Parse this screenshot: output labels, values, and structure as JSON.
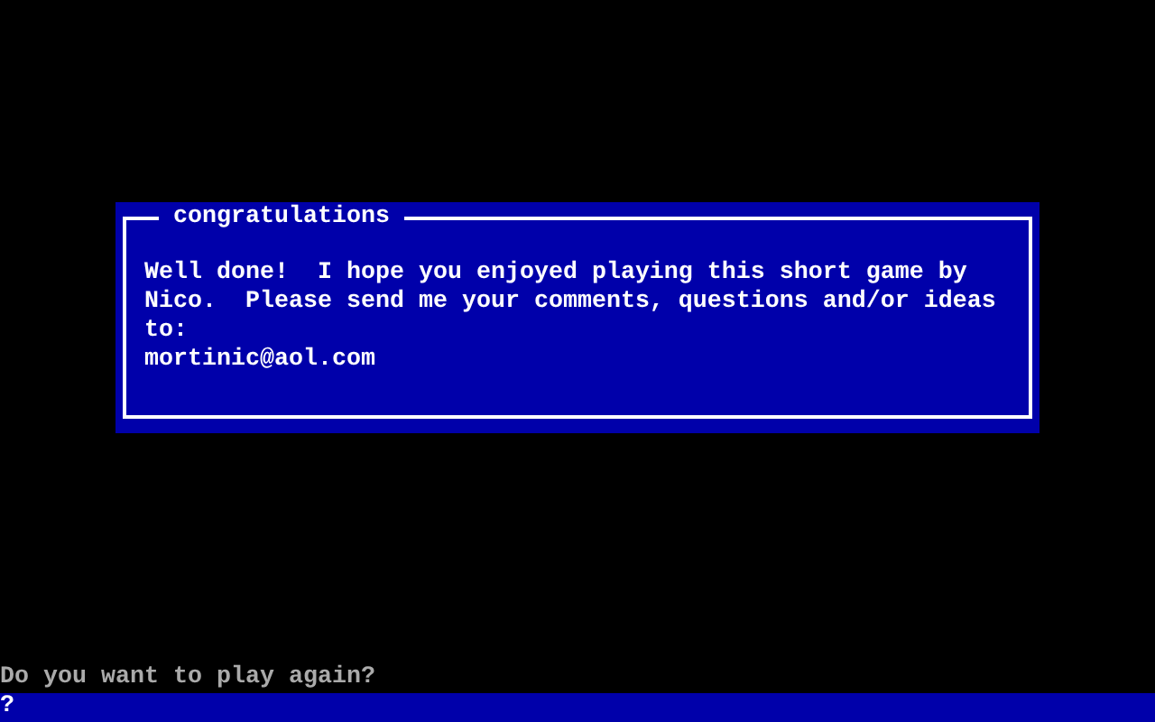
{
  "dialog": {
    "title": "congratulations",
    "message": [
      "Well done!  I hope you enjoyed playing this short game by",
      "Nico.  Please send me your comments, questions and/or ideas",
      "to:",
      "mortinic@aol.com"
    ]
  },
  "prompt": {
    "question": "Do you want to play again?",
    "input": "?"
  }
}
